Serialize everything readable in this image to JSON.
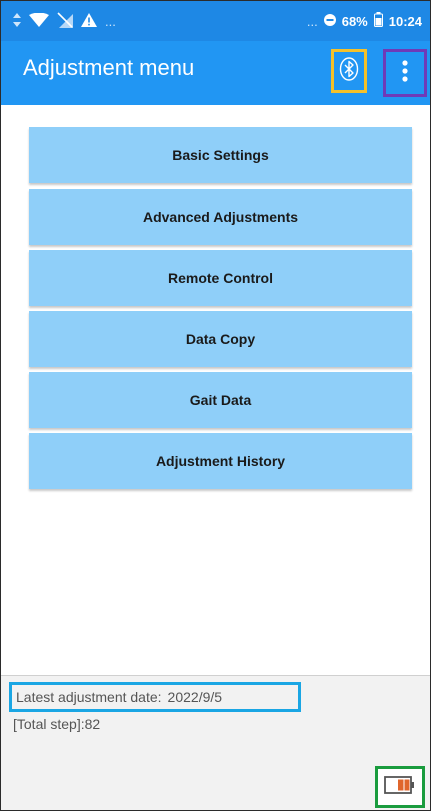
{
  "status_bar": {
    "left_icons": [
      "data-transfer-icon",
      "wifi-icon",
      "no-sim-icon",
      "alert-icon"
    ],
    "overflow": "...",
    "right_overflow": "...",
    "battery_percent": "68%",
    "time": "10:24"
  },
  "app_bar": {
    "title": "Adjustment menu",
    "bluetooth_icon": "bluetooth-icon",
    "menu_icon": "more-vert-icon"
  },
  "menu": {
    "items": [
      {
        "label": "Basic Settings"
      },
      {
        "label": "Advanced Adjustments"
      },
      {
        "label": "Remote Control"
      },
      {
        "label": "Data Copy"
      },
      {
        "label": "Gait Data"
      },
      {
        "label": "Adjustment History"
      }
    ]
  },
  "footer": {
    "latest_label": "Latest adjustment date:",
    "latest_date": "2022/9/5",
    "total_step": "[Total step]:82",
    "battery_icon": "battery-icon"
  },
  "colors": {
    "status_bar": "#1e88e5",
    "app_bar": "#2196f3",
    "menu_button": "#8fcff9",
    "bluetooth_highlight": "#f4c12b",
    "menu_highlight": "#6f3ab8",
    "date_highlight": "#1aa6e4",
    "battery_highlight": "#1a9c3e",
    "battery_fill": "#e0662c"
  }
}
